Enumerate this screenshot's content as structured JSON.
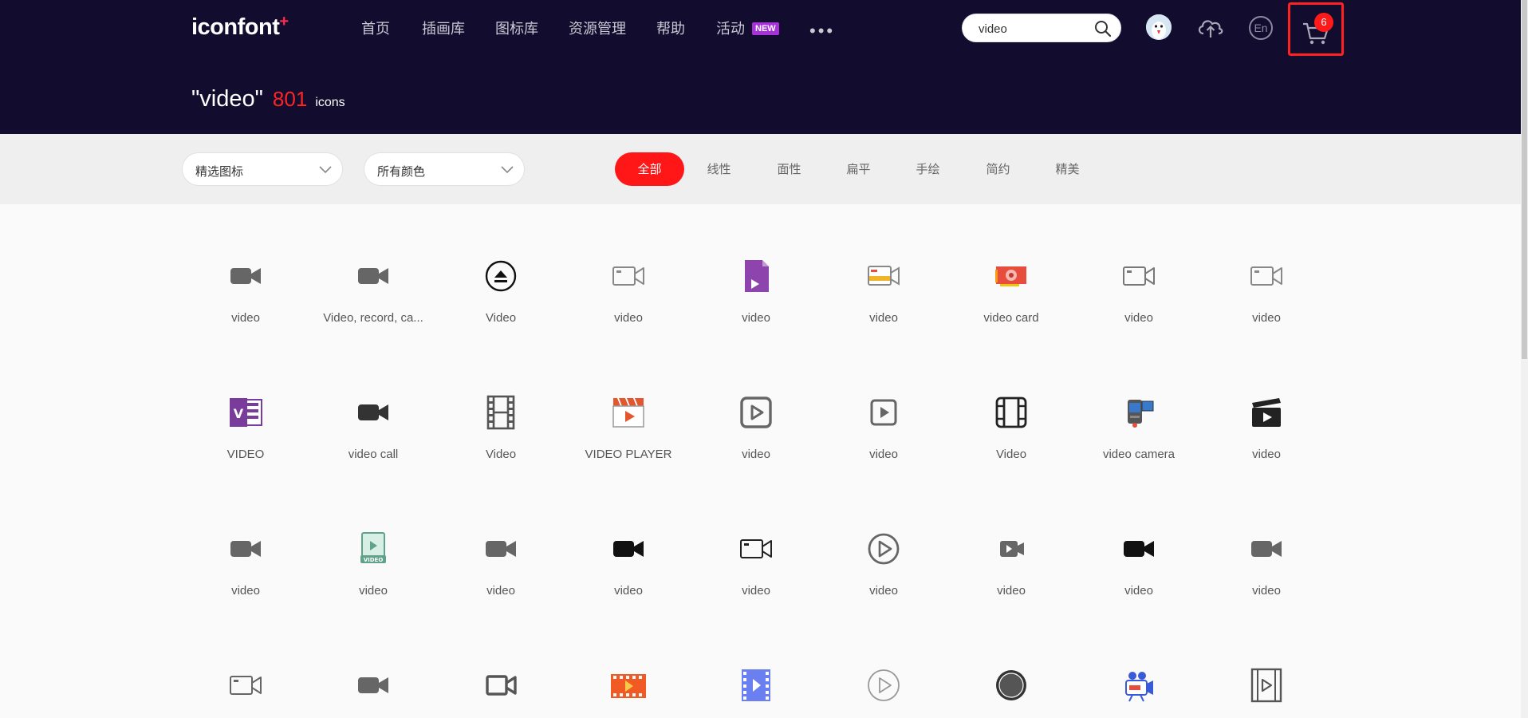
{
  "header": {
    "logo": "iconfont",
    "logo_plus": "+",
    "nav": [
      "首页",
      "插画库",
      "图标库",
      "资源管理",
      "帮助",
      "活动"
    ],
    "new_badge": "NEW",
    "more": "•••",
    "search_value": "video",
    "lang": "En",
    "cart_count": "6"
  },
  "query": {
    "term": "\"video\"",
    "count": "801",
    "unit": "icons"
  },
  "filters": {
    "dropdown1": "精选图标",
    "dropdown2": "所有颜色",
    "tabs": [
      "全部",
      "线性",
      "面性",
      "扁平",
      "手绘",
      "简约",
      "精美"
    ],
    "active_tab": "全部"
  },
  "colors": {
    "header_bg": "#120d2e",
    "accent_red": "#ff1616",
    "page_bg": "#fafafa"
  },
  "icons": [
    {
      "label": "video",
      "icon": "camera-solid",
      "color": "#666666"
    },
    {
      "label": "Video, record, ca...",
      "icon": "camera-solid",
      "color": "#666666"
    },
    {
      "label": "Video",
      "icon": "eject-circle",
      "color": "#111111"
    },
    {
      "label": "video",
      "icon": "camera-outline",
      "color": "#888888"
    },
    {
      "label": "video",
      "icon": "file-play",
      "color": "#8e44ad"
    },
    {
      "label": "video",
      "icon": "camera-color",
      "color": "#f0b429"
    },
    {
      "label": "video card",
      "icon": "graphics-card",
      "color": "#e74c3c"
    },
    {
      "label": "video",
      "icon": "camera-outline",
      "color": "#777777"
    },
    {
      "label": "video",
      "icon": "camera-outline",
      "color": "#888888"
    },
    {
      "label": "VIDEO",
      "icon": "vdoc",
      "color": "#7a3c9a"
    },
    {
      "label": "video call",
      "icon": "camera-solid",
      "color": "#333333"
    },
    {
      "label": "Video",
      "icon": "film-strip",
      "color": "#555555"
    },
    {
      "label": "VIDEO PLAYER",
      "icon": "clapper-player",
      "color": "#e4572e"
    },
    {
      "label": "video",
      "icon": "play-square",
      "color": "#666666"
    },
    {
      "label": "video",
      "icon": "play-square-small",
      "color": "#666666"
    },
    {
      "label": "Video",
      "icon": "film-frame",
      "color": "#222222"
    },
    {
      "label": "video camera",
      "icon": "handycam",
      "color": "#3a78c9"
    },
    {
      "label": "video",
      "icon": "clapperboard",
      "color": "#222222"
    },
    {
      "label": "video",
      "icon": "camera-solid",
      "color": "#666666"
    },
    {
      "label": "video",
      "icon": "film-green",
      "color": "#5fa38b"
    },
    {
      "label": "video",
      "icon": "camera-solid",
      "color": "#666666"
    },
    {
      "label": "video",
      "icon": "camera-solid",
      "color": "#111111"
    },
    {
      "label": "video",
      "icon": "camera-outline",
      "color": "#222222"
    },
    {
      "label": "video",
      "icon": "play-circle",
      "color": "#666666"
    },
    {
      "label": "video",
      "icon": "play-box-small",
      "color": "#666666"
    },
    {
      "label": "video",
      "icon": "camera-solid",
      "color": "#111111"
    },
    {
      "label": "video",
      "icon": "camera-solid",
      "color": "#666666"
    },
    {
      "label": "",
      "icon": "camera-outline",
      "color": "#666666"
    },
    {
      "label": "",
      "icon": "camera-solid",
      "color": "#666666"
    },
    {
      "label": "",
      "icon": "camera-outline-bold",
      "color": "#555555"
    },
    {
      "label": "",
      "icon": "film-orange",
      "color": "#f15a24"
    },
    {
      "label": "",
      "icon": "film-blue",
      "color": "#6a7ff0"
    },
    {
      "label": "",
      "icon": "play-circle-light",
      "color": "#999999"
    },
    {
      "label": "",
      "icon": "record-circle",
      "color": "#333333"
    },
    {
      "label": "",
      "icon": "camera-people",
      "color": "#3a5bd9"
    },
    {
      "label": "",
      "icon": "film-play",
      "color": "#555555"
    }
  ]
}
